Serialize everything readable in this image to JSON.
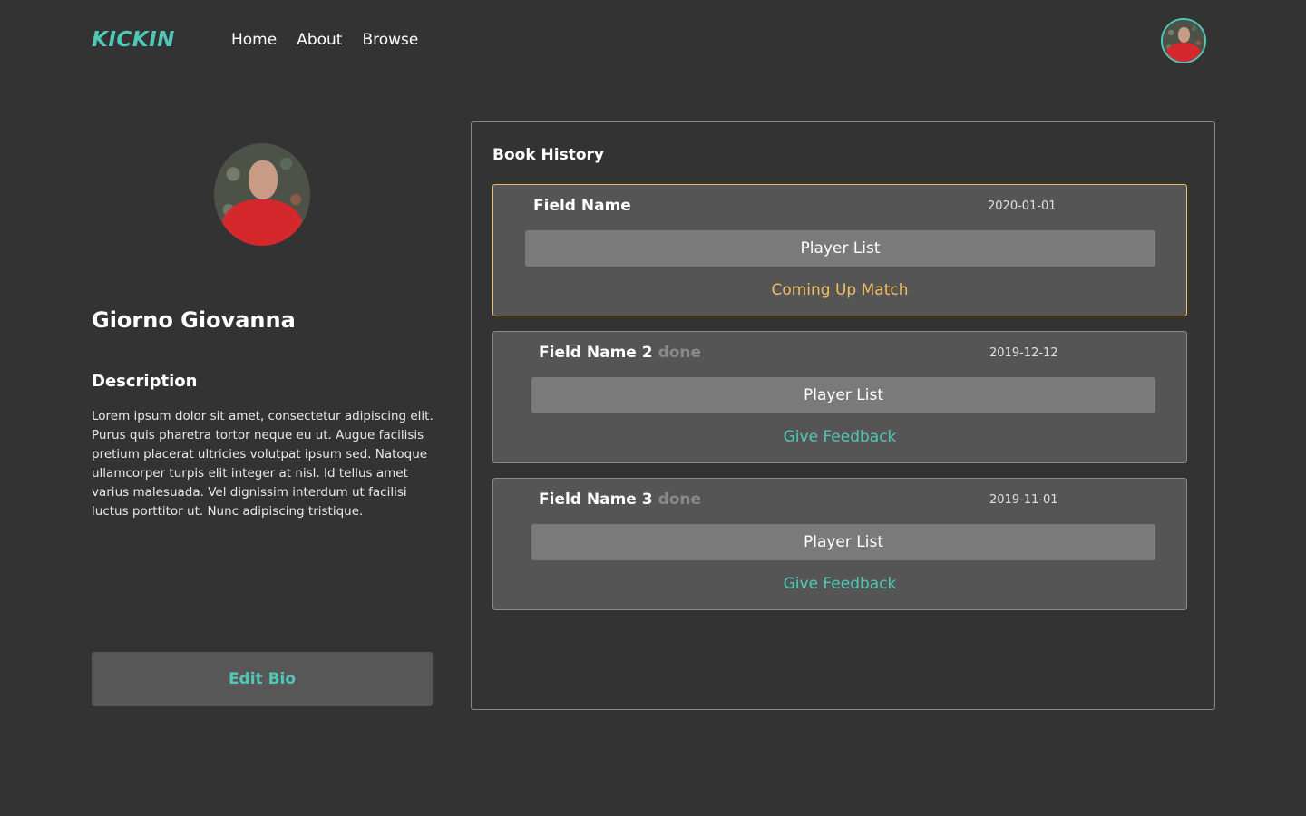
{
  "brand": {
    "logo": "KICKIN",
    "accent_color": "#4ec9b8"
  },
  "nav": {
    "items": [
      {
        "label": "Home"
      },
      {
        "label": "About"
      },
      {
        "label": "Browse"
      }
    ]
  },
  "profile": {
    "name": "Giorno Giovanna",
    "description_title": "Description",
    "description": "Lorem ipsum dolor sit amet, consectetur adipiscing elit. Purus quis pharetra tortor neque eu ut. Augue facilisis pretium placerat ultricies volutpat ipsum sed. Natoque ullamcorper turpis elit integer at nisl. Id tellus amet varius malesuada. Vel dignissim interdum ut facilisi luctus porttitor ut. Nunc adipiscing tristique.",
    "edit_label": "Edit Bio"
  },
  "history": {
    "title": "Book History",
    "bookings": [
      {
        "field": "Field Name",
        "status": "",
        "date": "2020-01-01",
        "player_list_label": "Player List",
        "action_label": "Coming Up Match",
        "highlight_color": "#f1bd62"
      },
      {
        "field": "Field Name 2",
        "status": "done",
        "date": "2019-12-12",
        "player_list_label": "Player List",
        "action_label": "Give Feedback"
      },
      {
        "field": "Field Name 3",
        "status": "done",
        "date": "2019-11-01",
        "player_list_label": "Player List",
        "action_label": "Give Feedback"
      }
    ]
  }
}
